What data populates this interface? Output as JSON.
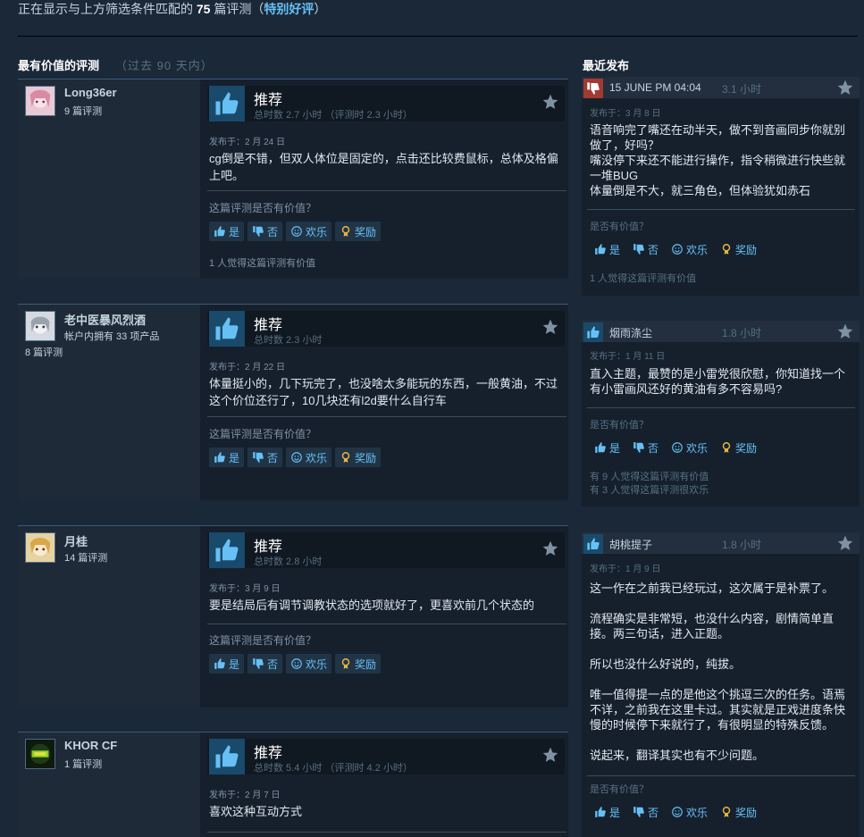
{
  "summary": {
    "prefix": "正在显示与上方筛选条件匹配的",
    "count": "75",
    "suffix": "篇评测（",
    "rating": "特别好评",
    "close": "）"
  },
  "sections": {
    "most_helpful": "最有价值的评测",
    "most_helpful_range": "（过去 90 天内）",
    "recent": "最近发布"
  },
  "labels": {
    "recommended": "推荐",
    "helpful_question": "这篇评测是否有价值？",
    "helpful_question_short": "是否有价值？",
    "yes": "是",
    "no": "否",
    "funny": "欢乐",
    "award": "奖励"
  },
  "colors": {
    "background": "#1b2838",
    "accent": "#66c0f4",
    "negative": "#a34c25"
  },
  "reviews": [
    {
      "author": "Long36er",
      "author_sub": "9 篇评测",
      "author_sub2": "",
      "hours": "总时数 2.7 小时 （评测时 2.3 小时）",
      "posted": "发布于：2 月 24 日",
      "text": "cg倒是不错，但双人体位是固定的，点击还比较费鼠标，总体及格偏上吧。",
      "helpful_count": "1 人觉得这篇评测有价值",
      "avatar": "anime-pink-avatar"
    },
    {
      "author": "老中医暴风烈酒",
      "author_sub": "帐户内拥有 33 项产品",
      "author_sub2": "8 篇评测",
      "hours": "总时数 2.3 小时",
      "posted": "发布于：2 月 22 日",
      "text": "体量挺小的，几下玩完了，也没啥太多能玩的东西，一般黄油，不过这个价位还行了，10几块还有l2d要什么自行车",
      "helpful_count": "",
      "avatar": "anime-white-avatar"
    },
    {
      "author": "月桂",
      "author_sub": "14 篇评测",
      "author_sub2": "",
      "hours": "总时数 2.8 小时",
      "posted": "发布于：3 月 9 日",
      "text": "要是结局后有调节调教状态的选项就好了，更喜欢前几个状态的",
      "helpful_count": "",
      "avatar": "anime-blonde-avatar"
    },
    {
      "author": "KHOR CF",
      "author_sub": "1 篇评测",
      "author_sub2": "",
      "hours": "总时数 5.4 小时 （评测时 4.2 小时）",
      "posted": "发布于：2 月 7 日",
      "text": "喜欢这种互动方式",
      "helpful_count": "",
      "avatar": "logo-avatar"
    }
  ],
  "recent": [
    {
      "name": "15 JUNE PM 04:04",
      "hours": "3.1 小时",
      "thumb": "thumbs-down-icon",
      "posted": "发布于：3 月 8 日",
      "paragraphs": [
        "语音响完了嘴还在动半天，做不到音画同步你就别做了，好吗？\n嘴没停下来还不能进行操作，指令稍微进行快些就一堆BUG\n体量倒是不大，就三角色，但体验犹如赤石"
      ],
      "counts": [
        "1 人觉得这篇评测有价值"
      ]
    },
    {
      "name": "烟雨涤尘",
      "hours": "1.8 小时",
      "thumb": "thumbs-up-icon",
      "posted": "发布于：1 月 11 日",
      "paragraphs": [
        "直入主题，最赞的是小雷党很欣慰，你知道找一个有小雷画风还好的黄油有多不容易吗?"
      ],
      "counts": [
        "有 9 人觉得这篇评测有价值",
        "有 3 人觉得这篇评测很欢乐"
      ]
    },
    {
      "name": "胡桃提子",
      "hours": "1.8 小时",
      "thumb": "thumbs-up-icon",
      "posted": "发布于：1 月 9 日",
      "paragraphs": [
        "这一作在之前我已经玩过，这次属于是补票了。",
        "流程确实是非常短，也没什么内容，剧情简单直接。两三句话，进入正题。",
        "所以也没什么好说的，纯拔。",
        "唯一值得提一点的是他这个挑逗三次的任务。语焉不详，之前我在这里卡过。其实就是正戏进度条快慢的时候停下来就行了，有很明显的特殊反馈。",
        "说起来，翻译其实也有不少问题。"
      ],
      "counts": []
    }
  ]
}
